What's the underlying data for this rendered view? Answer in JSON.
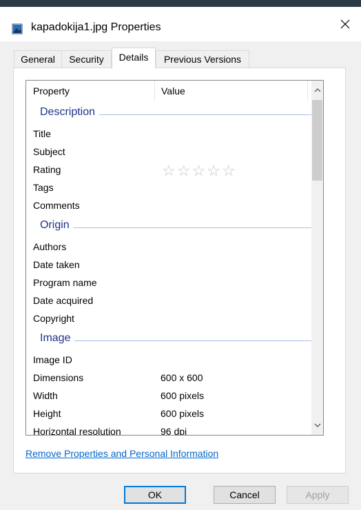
{
  "window": {
    "title": "kapadokija1.jpg Properties",
    "close_glyph": "✕",
    "icon": "image-file-icon"
  },
  "tabs": [
    {
      "label": "General",
      "active": false
    },
    {
      "label": "Security",
      "active": false
    },
    {
      "label": "Details",
      "active": true
    },
    {
      "label": "Previous Versions",
      "active": false
    }
  ],
  "list": {
    "columns": {
      "property": "Property",
      "value": "Value"
    },
    "groups": {
      "description": "Description",
      "origin": "Origin",
      "image": "Image"
    },
    "description_rows": [
      {
        "property": "Title",
        "value": ""
      },
      {
        "property": "Subject",
        "value": ""
      },
      {
        "property": "Rating",
        "value": ""
      },
      {
        "property": "Tags",
        "value": ""
      },
      {
        "property": "Comments",
        "value": ""
      }
    ],
    "rating": {
      "stars_filled": 0,
      "stars_total": 5,
      "glyph": "☆☆☆☆☆"
    },
    "origin_rows": [
      {
        "property": "Authors",
        "value": ""
      },
      {
        "property": "Date taken",
        "value": ""
      },
      {
        "property": "Program name",
        "value": ""
      },
      {
        "property": "Date acquired",
        "value": ""
      },
      {
        "property": "Copyright",
        "value": ""
      }
    ],
    "image_rows": [
      {
        "property": "Image ID",
        "value": ""
      },
      {
        "property": "Dimensions",
        "value": "600 x 600"
      },
      {
        "property": "Width",
        "value": "600 pixels"
      },
      {
        "property": "Height",
        "value": "600 pixels"
      },
      {
        "property": "Horizontal resolution",
        "value": "96 dpi"
      }
    ],
    "scroll": {
      "up_glyph": "⌃",
      "down_glyph": "⌄"
    }
  },
  "link": {
    "label": "Remove Properties and Personal Information"
  },
  "buttons": {
    "ok": "OK",
    "cancel": "Cancel",
    "apply": "Apply"
  },
  "colors": {
    "accent": "#0078d7",
    "group_title": "#1e3287",
    "link": "#0066cc"
  }
}
